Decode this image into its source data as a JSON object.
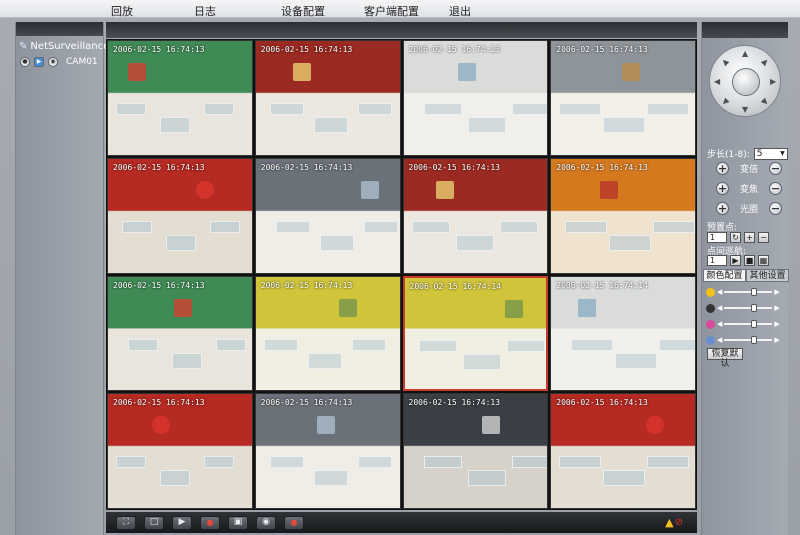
{
  "menu": [
    "回放",
    "日志",
    "设备配置",
    "客户端配置",
    "退出"
  ],
  "device_tree": {
    "root": "NetSurveillance",
    "camera": "CAM01"
  },
  "video_grid": {
    "cells": [
      {
        "timestamp": "2006-02-15 16:74:13",
        "theme": "shop-green"
      },
      {
        "timestamp": "2006-02-15 16:74:13",
        "theme": "shop-red"
      },
      {
        "timestamp": "2006-02-15 16:74:13",
        "theme": "shop-white"
      },
      {
        "timestamp": "2006-02-15 16:74:13",
        "theme": "floor-white"
      },
      {
        "timestamp": "2006-02-15 16:74:13",
        "theme": "lantern-red"
      },
      {
        "timestamp": "2006-02-15 16:74:13",
        "theme": "counter-white"
      },
      {
        "timestamp": "2006-02-15 16:74:13",
        "theme": "shop-red"
      },
      {
        "timestamp": "2006-02-15 16:74:13",
        "theme": "shop-orange"
      },
      {
        "timestamp": "2006-02-15 16:74:13",
        "theme": "shop-green"
      },
      {
        "timestamp": "2006-02-15 16:74:13",
        "theme": "shop-yellow"
      },
      {
        "timestamp": "2006-02-15 16:74:14",
        "theme": "shop-yellow"
      },
      {
        "timestamp": "2006-02-15 16:74:14",
        "theme": "shop-white"
      },
      {
        "timestamp": "2006-02-15 16:74:13",
        "theme": "lantern-red"
      },
      {
        "timestamp": "2006-02-15 16:74:13",
        "theme": "counter-white"
      },
      {
        "timestamp": "2006-02-15 16:74:13",
        "theme": "floor-dark"
      },
      {
        "timestamp": "2006-02-15 16:74:13",
        "theme": "lantern-red"
      }
    ],
    "selected_index": 10
  },
  "ptz": {
    "step_label": "步长(1-8):",
    "step_value": "5",
    "zoom_label": "变倍",
    "focus_label": "变焦",
    "iris_label": "光圈",
    "preset_label": "预置点:",
    "preset_value": "1",
    "cruise_label": "点间巡航:",
    "cruise_value": "1"
  },
  "tabs": [
    "颜色配置",
    "其他设置"
  ],
  "color_sliders": [
    {
      "name": "brightness",
      "icon_color": "#f2c21a",
      "level": 0.62
    },
    {
      "name": "contrast",
      "icon_color": "#333333",
      "level": 0.62
    },
    {
      "name": "saturation",
      "icon_color": "#d84a9a",
      "level": 0.62
    },
    {
      "name": "hue",
      "icon_color": "#6a8fd0",
      "level": 0.62
    }
  ],
  "reset_label": "恢复默认",
  "colors": {
    "accent_red": "#c83a2a",
    "panel_dark": "#2a2e33",
    "panel_grey": "#9aa0a7"
  }
}
